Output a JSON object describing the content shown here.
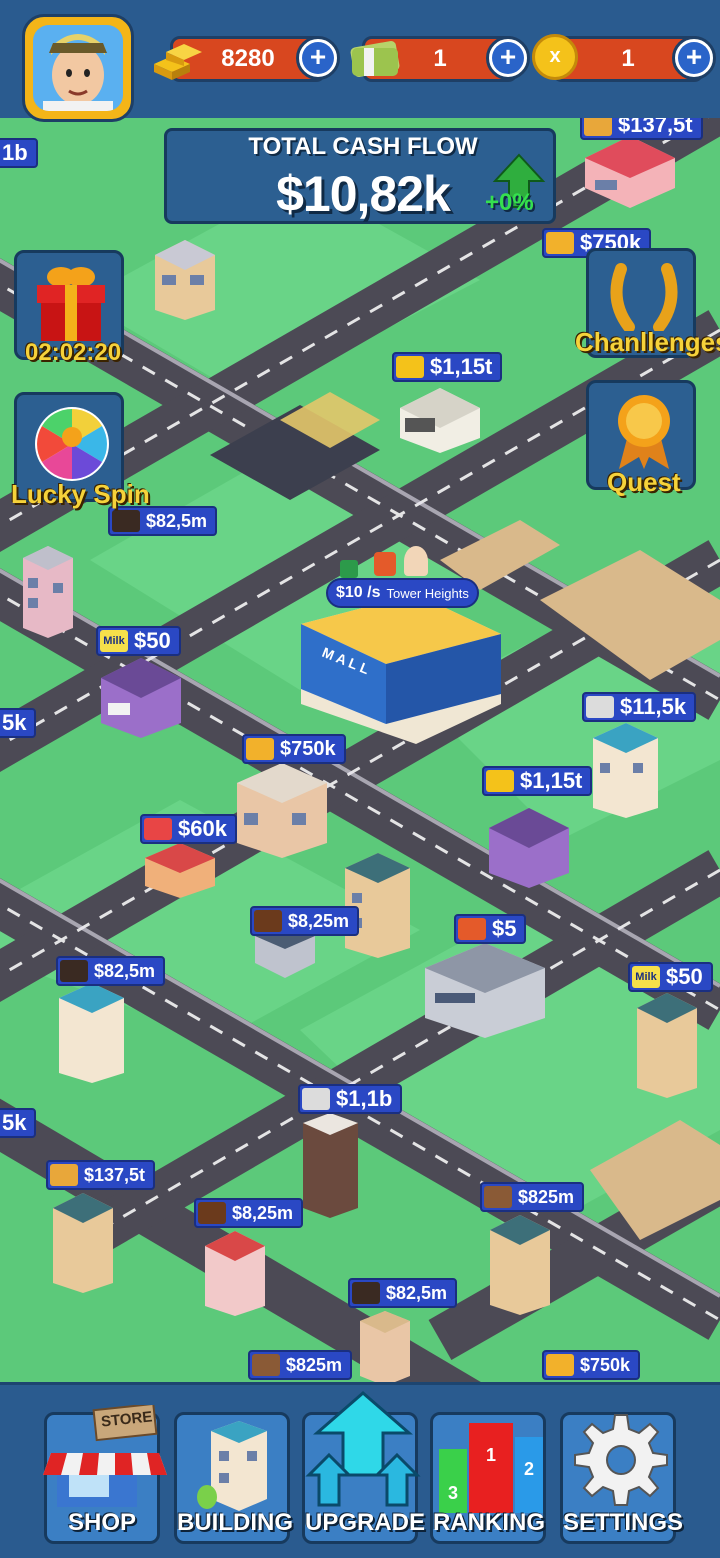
{
  "resources": {
    "gold": "8280",
    "cash": "1",
    "multiplier": "1",
    "multiplier_icon_text": "x"
  },
  "cashflow": {
    "title": "TOTAL CASH FLOW",
    "value": "$10,82k",
    "change": "+0%"
  },
  "side_buttons": {
    "gift_timer": "02:02:20",
    "lucky_spin": "Lucky Spin",
    "challenges": "Chanllenges",
    "quest": "Quest"
  },
  "map": {
    "mall": {
      "sign": "MALL",
      "rate": "$10 /s",
      "name": "Tower Heights"
    },
    "edge_labels": [
      "1b",
      "5k",
      "5k"
    ],
    "tags": [
      {
        "text": "$137,5t",
        "icon": "bread-icon",
        "color": "#e8a73a"
      },
      {
        "text": "$750k",
        "icon": "cheese-icon",
        "color": "#f2b12b"
      },
      {
        "text": "$1,15t",
        "icon": "ticket-icon",
        "color": "#f4c21a"
      },
      {
        "text": "$82,5m",
        "icon": "coffee-bag-icon",
        "color": "#3a2a22"
      },
      {
        "text": "$50",
        "icon": "milk-icon",
        "color": "#f6e04a"
      },
      {
        "text": "$750k",
        "icon": "cheese-icon",
        "color": "#f2b12b"
      },
      {
        "text": "$11,5k",
        "icon": "newspaper-icon",
        "color": "#dcdcdc"
      },
      {
        "text": "$1,15t",
        "icon": "ticket-icon",
        "color": "#f4c21a"
      },
      {
        "text": "$60k",
        "icon": "candy-icon",
        "color": "#e84545"
      },
      {
        "text": "$8,25m",
        "icon": "barrel-icon",
        "color": "#6b3a1c"
      },
      {
        "text": "$5",
        "icon": "juice-icon",
        "color": "#e45a2a"
      },
      {
        "text": "$82,5m",
        "icon": "coffee-bag-icon",
        "color": "#3a2a22"
      },
      {
        "text": "$50",
        "icon": "milk-icon",
        "color": "#f6e04a"
      },
      {
        "text": "$1,1b",
        "icon": "paper-icon",
        "color": "#dcdcdc"
      },
      {
        "text": "$137,5t",
        "icon": "bread-icon",
        "color": "#e8a73a"
      },
      {
        "text": "$8,25m",
        "icon": "barrel-icon",
        "color": "#6b3a1c"
      },
      {
        "text": "$825m",
        "icon": "chocolate-icon",
        "color": "#8a5a36"
      },
      {
        "text": "$82,5m",
        "icon": "coffee-bag-icon",
        "color": "#3a2a22"
      },
      {
        "text": "$825m",
        "icon": "chocolate-icon",
        "color": "#8a5a36"
      },
      {
        "text": "$750k",
        "icon": "cheese-icon",
        "color": "#f2b12b"
      }
    ],
    "milk_text": "Milk"
  },
  "nav": {
    "shop": "SHOP",
    "shop_sign": "STORE",
    "building": "BUILDING",
    "upgrade": "UPGRADE",
    "ranking": "RANKING",
    "rank_1": "1",
    "rank_2": "2",
    "rank_3": "3",
    "settings": "SETTINGS"
  },
  "colors": {
    "panel": "#2c5f91",
    "resource_bar": "#d8471f",
    "grass": "#5cc97a",
    "road": "#4c4a55",
    "tag": "#2a48c4",
    "label_gold": "#f6d23a"
  }
}
